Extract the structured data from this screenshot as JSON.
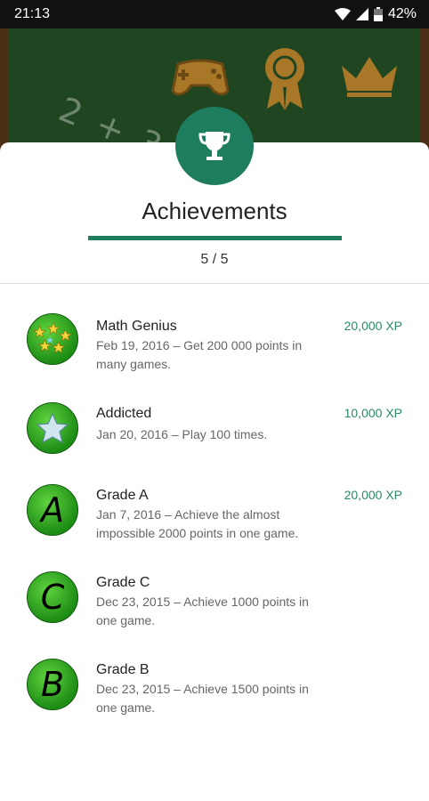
{
  "status_bar": {
    "time": "21:13",
    "battery": "42%"
  },
  "background": {
    "chalk_text": "2 + 3 ="
  },
  "sheet": {
    "title": "Achievements",
    "count": "5 / 5"
  },
  "achievements": [
    {
      "name": "Math Genius",
      "description": "Feb 19, 2016 – Get 200 000 points in many games.",
      "xp": "20,000 XP",
      "badge": "stars"
    },
    {
      "name": "Addicted",
      "description": "Jan 20, 2016 – Play 100 times.",
      "xp": "10,000 XP",
      "badge": "star"
    },
    {
      "name": "Grade A",
      "description": "Jan 7, 2016 – Achieve the almost impossible 2000 points in one game.",
      "xp": "20,000 XP",
      "badge": "A"
    },
    {
      "name": "Grade C",
      "description": "Dec 23, 2015 – Achieve 1000 points in one game.",
      "xp": "",
      "badge": "C"
    },
    {
      "name": "Grade B",
      "description": "Dec 23, 2015 – Achieve 1500 points in one game.",
      "xp": "",
      "badge": "B"
    }
  ],
  "colors": {
    "accent": "#1e7d5e",
    "xp": "#2a8a6a",
    "badge_green": "#2a9d1c",
    "board": "#1f4620",
    "frame": "#4a2e16"
  }
}
